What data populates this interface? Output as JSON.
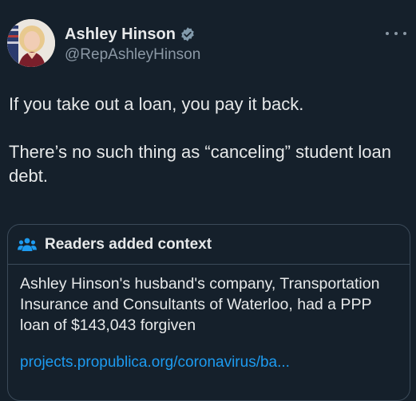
{
  "author": {
    "display_name": "Ashley Hinson",
    "handle": "@RepAshleyHinson",
    "avatar_icon": "profile-photo",
    "verified_icon": "verified-badge-icon"
  },
  "tweet": {
    "text": "If you take out a loan, you pay it back.\n\nThere’s no such thing as “canceling” student loan debt."
  },
  "context_note": {
    "title": "Readers added context",
    "body": "Ashley Hinson's husband's company, Transportation Insurance and Consultants of Waterloo, had a PPP loan of $143,043 forgiven",
    "link": "projects.propublica.org/coronavirus/ba..."
  },
  "colors": {
    "background": "#15202b",
    "text": "#e7e9ea",
    "secondary_text": "#8b98a5",
    "link": "#1d9bf0",
    "note_icon": "#1d9bf0",
    "border": "#3b4a59"
  }
}
